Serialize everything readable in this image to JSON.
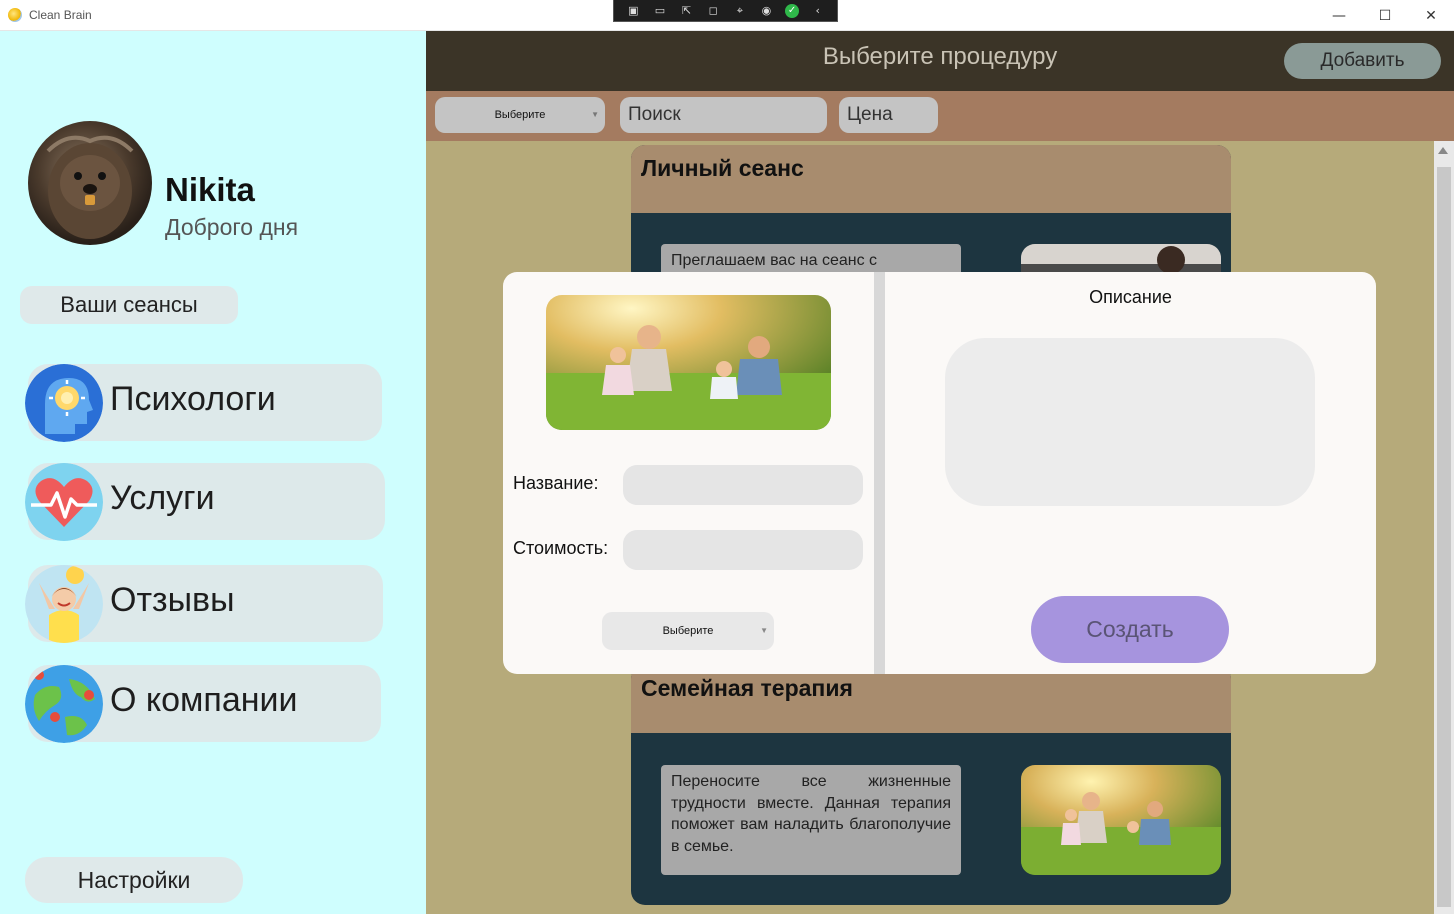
{
  "window": {
    "title": "Clean Brain",
    "minimize_glyph": "—",
    "maximize_glyph": "☐",
    "close_glyph": "✕"
  },
  "debug_toolbar": {
    "icons": [
      "live-visual-tree-icon",
      "record-icon",
      "select-element-icon",
      "display-layout-adorners-icon",
      "track-focus-icon",
      "hot-reload-icon",
      "check-icon",
      "collapse-icon"
    ]
  },
  "sidebar": {
    "user": {
      "name": "Nikita",
      "greeting": "Доброго дня"
    },
    "sessions_label": "Ваши сеансы",
    "items": [
      {
        "label": "Психологи",
        "icon": "psychology-head-icon"
      },
      {
        "label": "Услуги",
        "icon": "heart-pulse-icon"
      },
      {
        "label": "Отзывы",
        "icon": "happy-person-icon"
      },
      {
        "label": "О компании",
        "icon": "globe-pins-icon"
      }
    ],
    "settings_label": "Настройки"
  },
  "header": {
    "title": "Выберите процедуру",
    "add_label": "Добавить"
  },
  "filters": {
    "category_value": "Выберите",
    "search_placeholder": "Поиск",
    "price_placeholder": "Цена"
  },
  "cards": [
    {
      "title": "Личный сеанс",
      "description": "Преглашаем вас на сеанс с"
    },
    {
      "title": "Семейная терапия",
      "description": "Переносите все жизненные трудности вместе. Данная терапия поможет вам наладить благополучие в семье."
    }
  ],
  "modal": {
    "name_label": "Название:",
    "cost_label": "Стоимость:",
    "category_value": "Выберите",
    "description_title": "Описание",
    "create_label": "Создать"
  },
  "colors": {
    "sidebar_bg": "#cffefe",
    "header_bg": "#3b3427",
    "filter_bg": "#a47b60",
    "content_bg": "#b6aa7a",
    "card_head": "#a88c6e",
    "card_body": "#1d3540",
    "create_button": "#a694de"
  }
}
